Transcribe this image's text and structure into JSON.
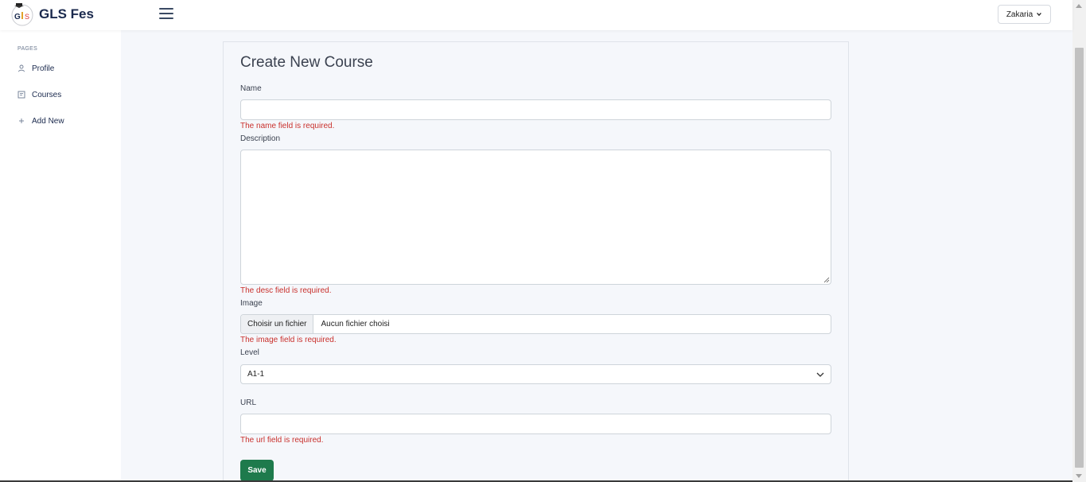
{
  "navbar": {
    "brand_text": "GLS Fes",
    "user_name": "Zakaria"
  },
  "sidebar": {
    "header": "PAGES",
    "items": [
      {
        "label": "Profile",
        "icon": "user-icon"
      },
      {
        "label": "Courses",
        "icon": "book-icon"
      },
      {
        "label": "Add New",
        "icon": "plus-icon"
      }
    ]
  },
  "form": {
    "title": "Create New Course",
    "name_label": "Name",
    "name_value": "",
    "name_error": "The name field is required.",
    "desc_label": "Description",
    "desc_value": "",
    "desc_error": "The desc field is required.",
    "image_label": "Image",
    "file_button": "Choisir un fichier",
    "file_status": "Aucun fichier choisi",
    "image_error": "The image field is required.",
    "level_label": "Level",
    "level_selected": "A1-1",
    "url_label": "URL",
    "url_value": "",
    "url_error": "The url field is required.",
    "save_label": "Save"
  },
  "colors": {
    "error": "#c9302c",
    "save_button": "#1e7a4c",
    "brand_text": "#1b2a4e"
  }
}
